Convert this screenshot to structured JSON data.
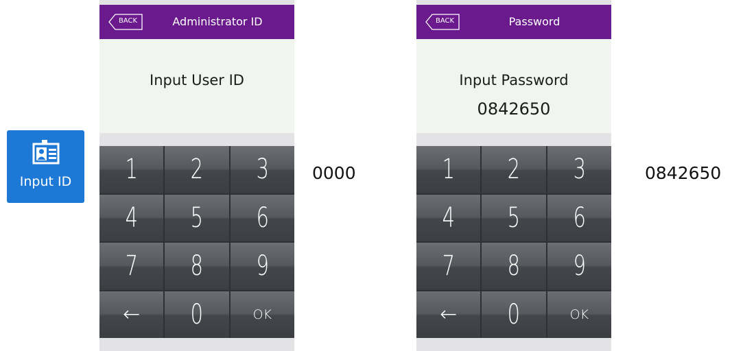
{
  "input_id_button": {
    "label": "Input ID",
    "icon": "id-card-icon",
    "color": "#1e79d6"
  },
  "header_color": "#6a1a8c",
  "screens": [
    {
      "back_label": "BACK",
      "title": "Administrator ID",
      "prompt": "Input User ID",
      "display_value": "",
      "keys": [
        "1",
        "2",
        "3",
        "4",
        "5",
        "6",
        "7",
        "8",
        "9",
        "←",
        "0",
        "OK"
      ],
      "entered_value": "0000"
    },
    {
      "back_label": "BACK",
      "title": "Password",
      "prompt": "Input Password",
      "display_value": "0842650",
      "keys": [
        "1",
        "2",
        "3",
        "4",
        "5",
        "6",
        "7",
        "8",
        "9",
        "←",
        "0",
        "OK"
      ],
      "entered_value": "0842650"
    }
  ]
}
